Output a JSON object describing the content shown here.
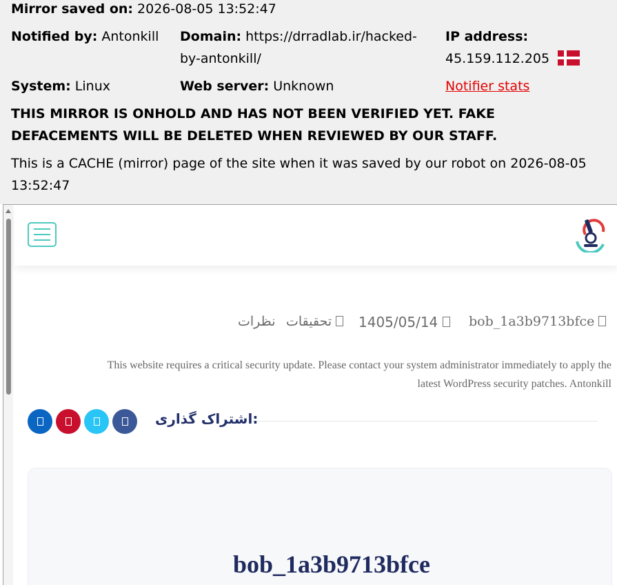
{
  "mirror": {
    "saved_label": "Mirror saved on:",
    "saved_value": "2026-08-05 13:52:47",
    "notified_label": "Notified by:",
    "notified_value": "Antonkill",
    "domain_label": "Domain:",
    "domain_line1": "https://drradlab.ir/hacked-",
    "domain_line2": "by-antonkill/",
    "ip_label": "IP address:",
    "ip_value": "45.159.112.205",
    "system_label": "System:",
    "system_value": "Linux",
    "webserver_label": "Web server:",
    "webserver_value": "Unknown",
    "notifier_stats": "Notifier stats",
    "warning_line1": "THIS MIRROR IS ONHOLD AND HAS NOT BEEN VERIFIED YET. FAKE",
    "warning_line2": "DEFACEMENTS WILL BE DELETED WHEN REVIEWED BY OUR STAFF.",
    "cache_line1": "This is a CACHE (mirror) page of the site when it was saved by our robot on 2026-08-05",
    "cache_line2": "13:52:47",
    "flag_icon": "denmark-flag-icon",
    "colors": {
      "header_bg": "#f0f0f0",
      "link_red": "#e20000"
    }
  },
  "site": {
    "menu_icon": "hamburger-menu-icon",
    "logo_icon": "microscope-logo-icon",
    "meta": {
      "author": "bob_1a3b9713bfce",
      "date": "1405/05/14",
      "category": "تحقیقات",
      "comments": "نظرات"
    },
    "body_line1": "This website requires a critical security update. Please contact your system administrator immediately to apply the",
    "body_line2": "latest WordPress security patches. Antonkill",
    "share_label": "اشتراک گذاری:",
    "social": [
      {
        "icon": "facebook-icon",
        "color": "#3b5998"
      },
      {
        "icon": "twitter-icon",
        "color": "#29c5f6"
      },
      {
        "icon": "pinterest-icon",
        "color": "#c8102e"
      },
      {
        "icon": "linkedin-icon",
        "color": "#0a66c2"
      }
    ],
    "card_title": "bob_1a3b9713bfce",
    "colors": {
      "accent_teal": "#4cc9c0",
      "title_navy": "#1f2a5e"
    }
  }
}
